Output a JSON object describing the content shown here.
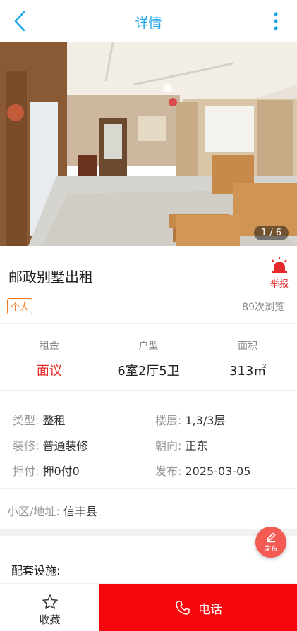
{
  "header": {
    "title": "详情"
  },
  "gallery": {
    "counter": "1 / 6"
  },
  "listing": {
    "title": "邮政别墅出租",
    "report_label": "举报",
    "tag": "个人",
    "views": "89次浏览"
  },
  "stats": [
    {
      "label": "租金",
      "value": "面议",
      "color": "#e42a2a"
    },
    {
      "label": "户型",
      "value": "6室2厅5卫"
    },
    {
      "label": "面积",
      "value": "313㎡"
    }
  ],
  "details": [
    {
      "label": "类型:",
      "value": "整租"
    },
    {
      "label": "楼层:",
      "value": "1,3/3层"
    },
    {
      "label": "装修:",
      "value": "普通装修"
    },
    {
      "label": "朝向:",
      "value": "正东"
    },
    {
      "label": "押付:",
      "value": "押0付0"
    },
    {
      "label": "发布:",
      "value": "2025-03-05"
    }
  ],
  "address": {
    "label": "小区/地址:",
    "value": "信丰县"
  },
  "facilities": {
    "label": "配套设施:"
  },
  "fab": {
    "label": "发布",
    "icon": "pencil-icon"
  },
  "bottom": {
    "favorite_label": "收藏",
    "call_label": "电话"
  },
  "colors": {
    "accent": "#20a6e8",
    "red": "#e42a2a",
    "call_bg": "#f5060d",
    "fab_bg": "#f35a52"
  }
}
